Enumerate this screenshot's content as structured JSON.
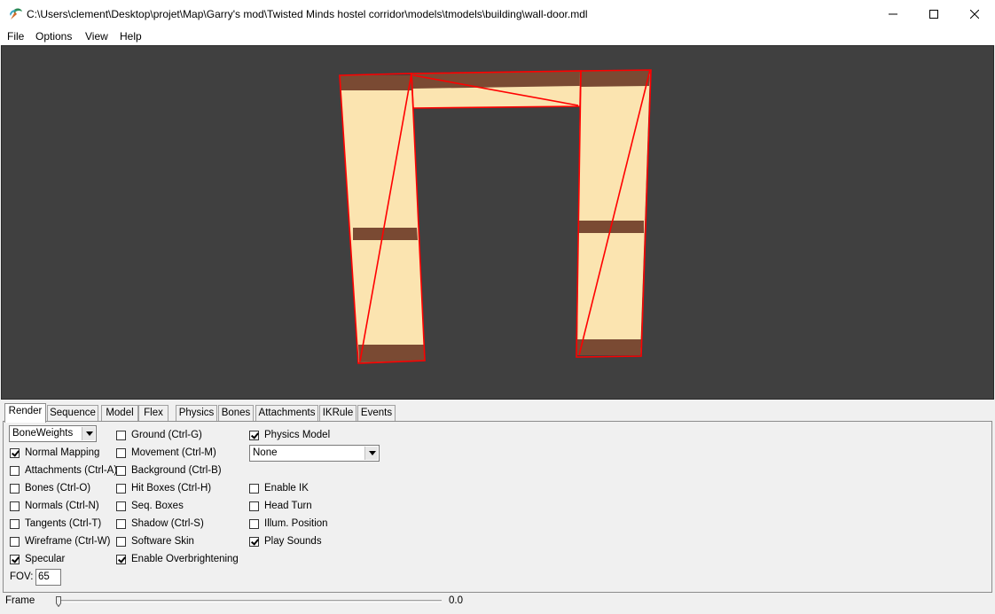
{
  "window": {
    "title": "C:\\Users\\clement\\Desktop\\projet\\Map\\Garry's mod\\Twisted Minds hostel corridor\\models\\tmodels\\building\\wall-door.mdl"
  },
  "menu": {
    "file": "File",
    "options": "Options",
    "view": "View",
    "help": "Help"
  },
  "tabs": [
    {
      "label": "Render",
      "active": true
    },
    {
      "label": "Sequence"
    },
    {
      "label": "Model"
    },
    {
      "label": "Flex"
    },
    {
      "label": "Physics"
    },
    {
      "label": "Bones"
    },
    {
      "label": "Attachments"
    },
    {
      "label": "IKRule"
    },
    {
      "label": "Events"
    }
  ],
  "render": {
    "render_mode": "BoneWeights",
    "col1": [
      {
        "label": "Normal Mapping",
        "checked": true
      },
      {
        "label": "Attachments (Ctrl-A)",
        "checked": false
      },
      {
        "label": "Bones (Ctrl-O)",
        "checked": false
      },
      {
        "label": "Normals (Ctrl-N)",
        "checked": false
      },
      {
        "label": "Tangents (Ctrl-T)",
        "checked": false
      },
      {
        "label": "Wireframe (Ctrl-W)",
        "checked": false
      },
      {
        "label": "Specular",
        "checked": true
      }
    ],
    "col2": [
      {
        "label": "Ground (Ctrl-G)",
        "checked": false
      },
      {
        "label": "Movement (Ctrl-M)",
        "checked": false
      },
      {
        "label": "Background (Ctrl-B)",
        "checked": false
      },
      {
        "label": "Hit Boxes (Ctrl-H)",
        "checked": false
      },
      {
        "label": "Seq. Boxes",
        "checked": false
      },
      {
        "label": "Shadow (Ctrl-S)",
        "checked": false
      },
      {
        "label": "Software Skin",
        "checked": false
      },
      {
        "label": "Enable Overbrightening",
        "checked": true
      }
    ],
    "physics_model": {
      "label": "Physics Model",
      "checked": true
    },
    "physics_select": "None",
    "col3": [
      {
        "label": "Enable IK",
        "checked": false
      },
      {
        "label": "Head Turn",
        "checked": false
      },
      {
        "label": "Illum. Position",
        "checked": false
      },
      {
        "label": "Play Sounds",
        "checked": true
      }
    ],
    "fov_label": "FOV:",
    "fov_value": "65"
  },
  "frame": {
    "label": "Frame",
    "value": "0.0",
    "position": 0
  },
  "colors": {
    "viewport_bg": "#404040",
    "wall_fill": "#fbe4b0",
    "trim": "#7a4a33",
    "physics_outline": "#ff0000"
  }
}
